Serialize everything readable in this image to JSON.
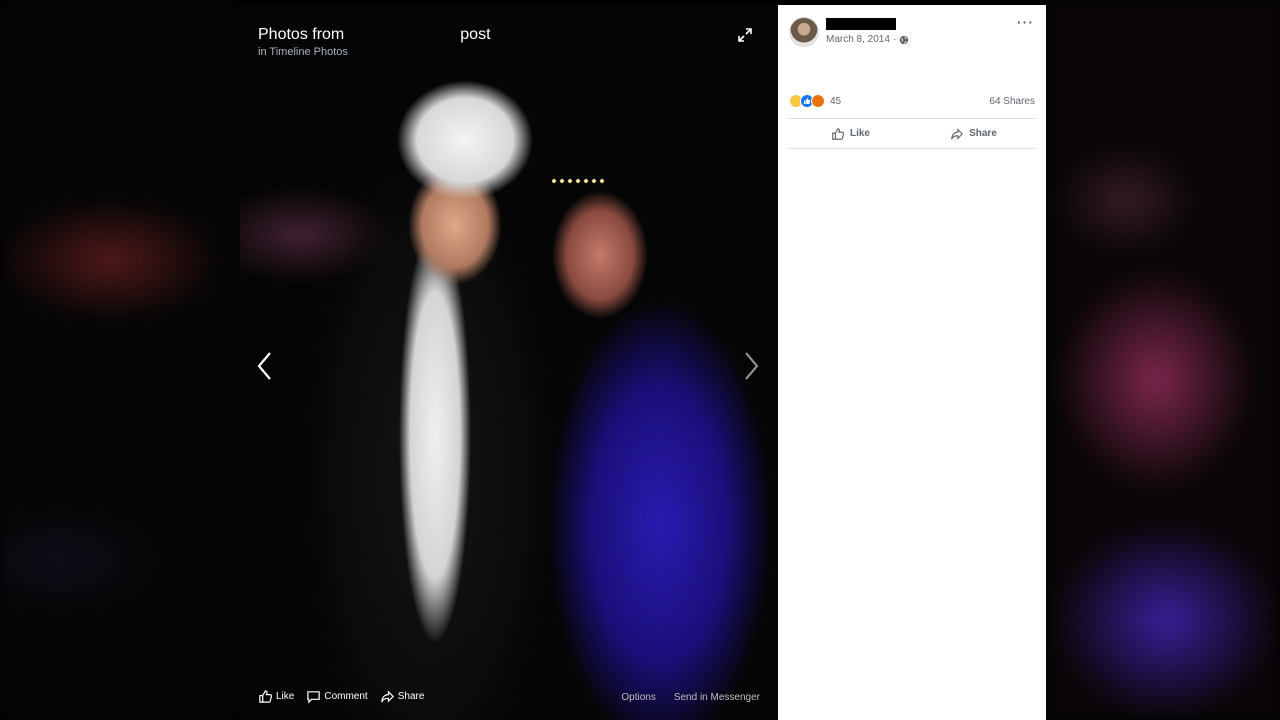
{
  "viewer": {
    "title_prefix": "Photos from",
    "title_suffix": "post",
    "sub_in": "in",
    "sub_album": "Timeline Photos",
    "actions": {
      "like": "Like",
      "comment": "Comment",
      "share": "Share"
    },
    "options": "Options",
    "send_messenger": "Send in Messenger"
  },
  "post": {
    "date": "March 8, 2014",
    "reaction_count": "45",
    "shares": "64 Shares",
    "like_label": "Like",
    "share_label": "Share"
  },
  "icons": {
    "expand": "expand-icon",
    "prev": "chevron-left-icon",
    "next": "chevron-right-icon",
    "globe": "globe-icon",
    "more": "more-icon"
  },
  "colors": {
    "like_blue": "#1877f2",
    "haha_yellow": "#f7c844",
    "angry_orange": "#e9710f",
    "meta_gray": "#606770"
  }
}
